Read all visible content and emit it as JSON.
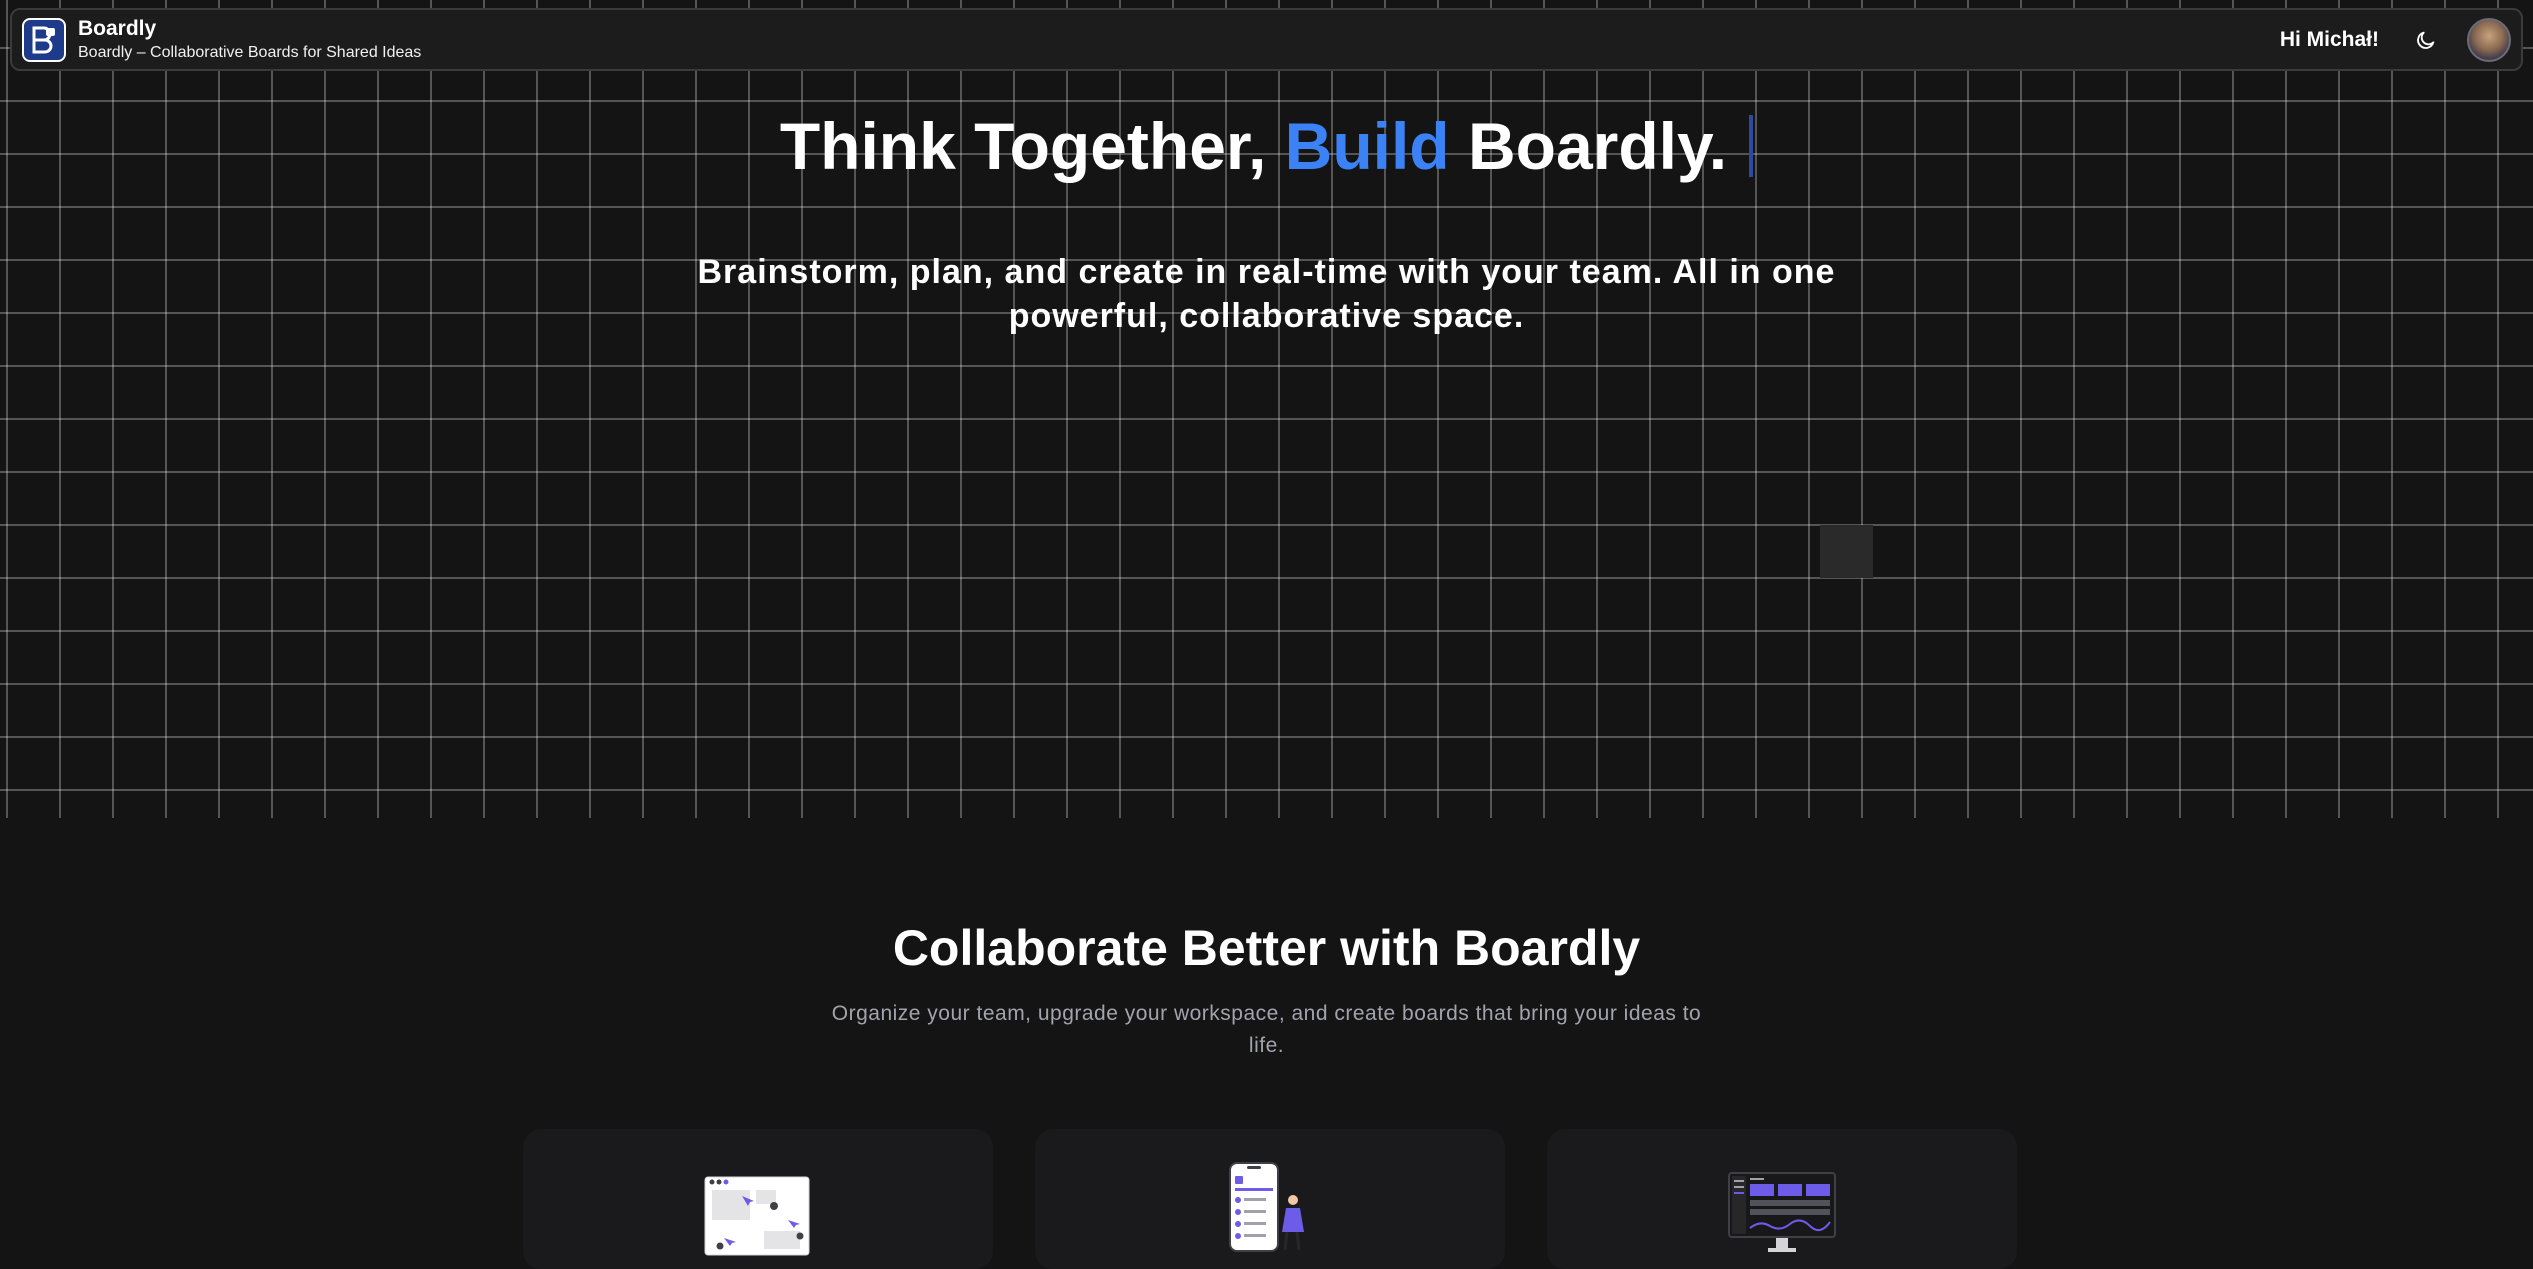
{
  "header": {
    "app_name": "Boardly",
    "tagline": "Boardly – Collaborative Boards for Shared Ideas",
    "greeting": "Hi Michał!",
    "theme_icon": "moon-icon",
    "avatar_icon": "user-avatar"
  },
  "hero": {
    "title_before": "Think Together,",
    "title_accent": "Build",
    "title_after": "Boardly.",
    "subtitle": "Brainstorm, plan, and create in real-time with your team. All in one powerful, collaborative space."
  },
  "features": {
    "title": "Collaborate Better with Boardly",
    "subtitle": "Organize your team, upgrade your workspace, and create boards that bring your ideas to life.",
    "cards": [
      {
        "illustration": "whiteboard-illustration"
      },
      {
        "illustration": "mobile-app-illustration"
      },
      {
        "illustration": "dashboard-illustration"
      }
    ]
  },
  "colors": {
    "accent": "#3b82f6",
    "background": "#141414",
    "header_bg": "#1c1c1c",
    "card_bg": "#1a1a1c"
  }
}
